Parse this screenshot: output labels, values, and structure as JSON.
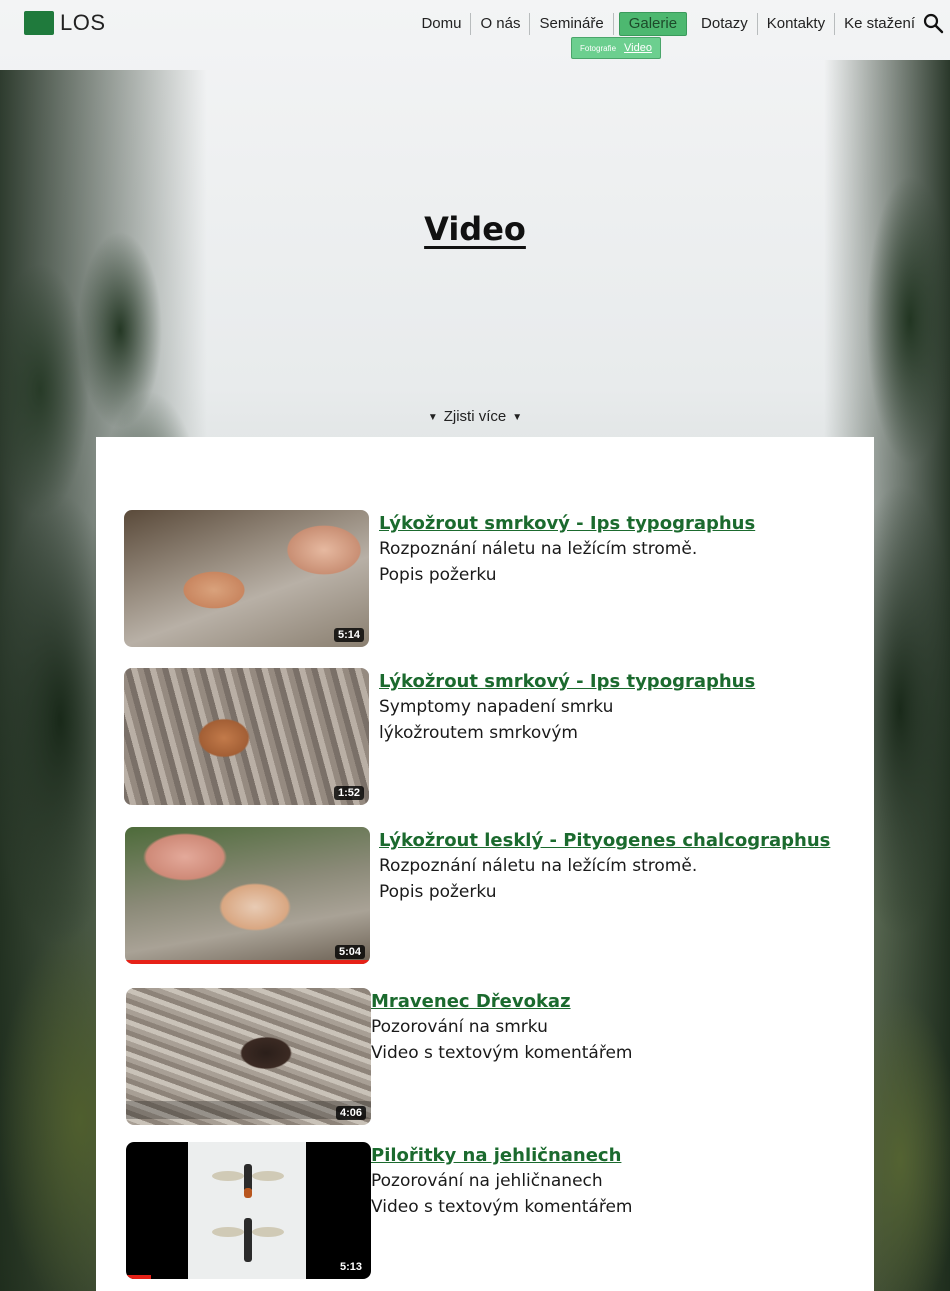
{
  "header": {
    "logo_text": "LOS",
    "nav": [
      "Domu",
      "O nás",
      "Semináře",
      "Galerie",
      "Dotazy",
      "Kontakty",
      "Ke stažení"
    ],
    "active_index": 3,
    "submenu": {
      "photo": "Fotografie",
      "video": "Video"
    }
  },
  "hero": {
    "title": "Video",
    "more_link": "Zjisti více"
  },
  "videos": [
    {
      "title": "Lýkožrout smrkový - Ips typographus",
      "lines": [
        "Rozpoznání náletu na ležícím stromě.",
        "Popis požerku"
      ],
      "duration": "5:14",
      "watched_fraction": 0
    },
    {
      "title": "Lýkožrout smrkový - Ips typographus",
      "lines": [
        "Symptomy napadení smrku",
        "lýkožroutem smrkovým"
      ],
      "duration": "1:52",
      "watched_fraction": 0
    },
    {
      "title": "Lýkožrout lesklý - Pityogenes chalcographus",
      "lines": [
        "Rozpoznání náletu na ležícím stromě.",
        "Popis požerku"
      ],
      "duration": "5:04",
      "watched_fraction": 1
    },
    {
      "title": "Mravenec Dřevokaz",
      "lines": [
        "Pozorování na smrku",
        "Video s textovým komentářem"
      ],
      "duration": "4:06",
      "watched_fraction": 0
    },
    {
      "title": "Pilořitky na jehličnanech",
      "lines": [
        "Pozorování na jehličnanech",
        "Video s textovým komentářem"
      ],
      "duration": "5:13",
      "watched_fraction": 0.1
    }
  ],
  "colors": {
    "accent_green": "#1b6a2e",
    "nav_active": "#4db870",
    "logo_green": "#1f7a3c",
    "progress_red": "#e62117"
  }
}
